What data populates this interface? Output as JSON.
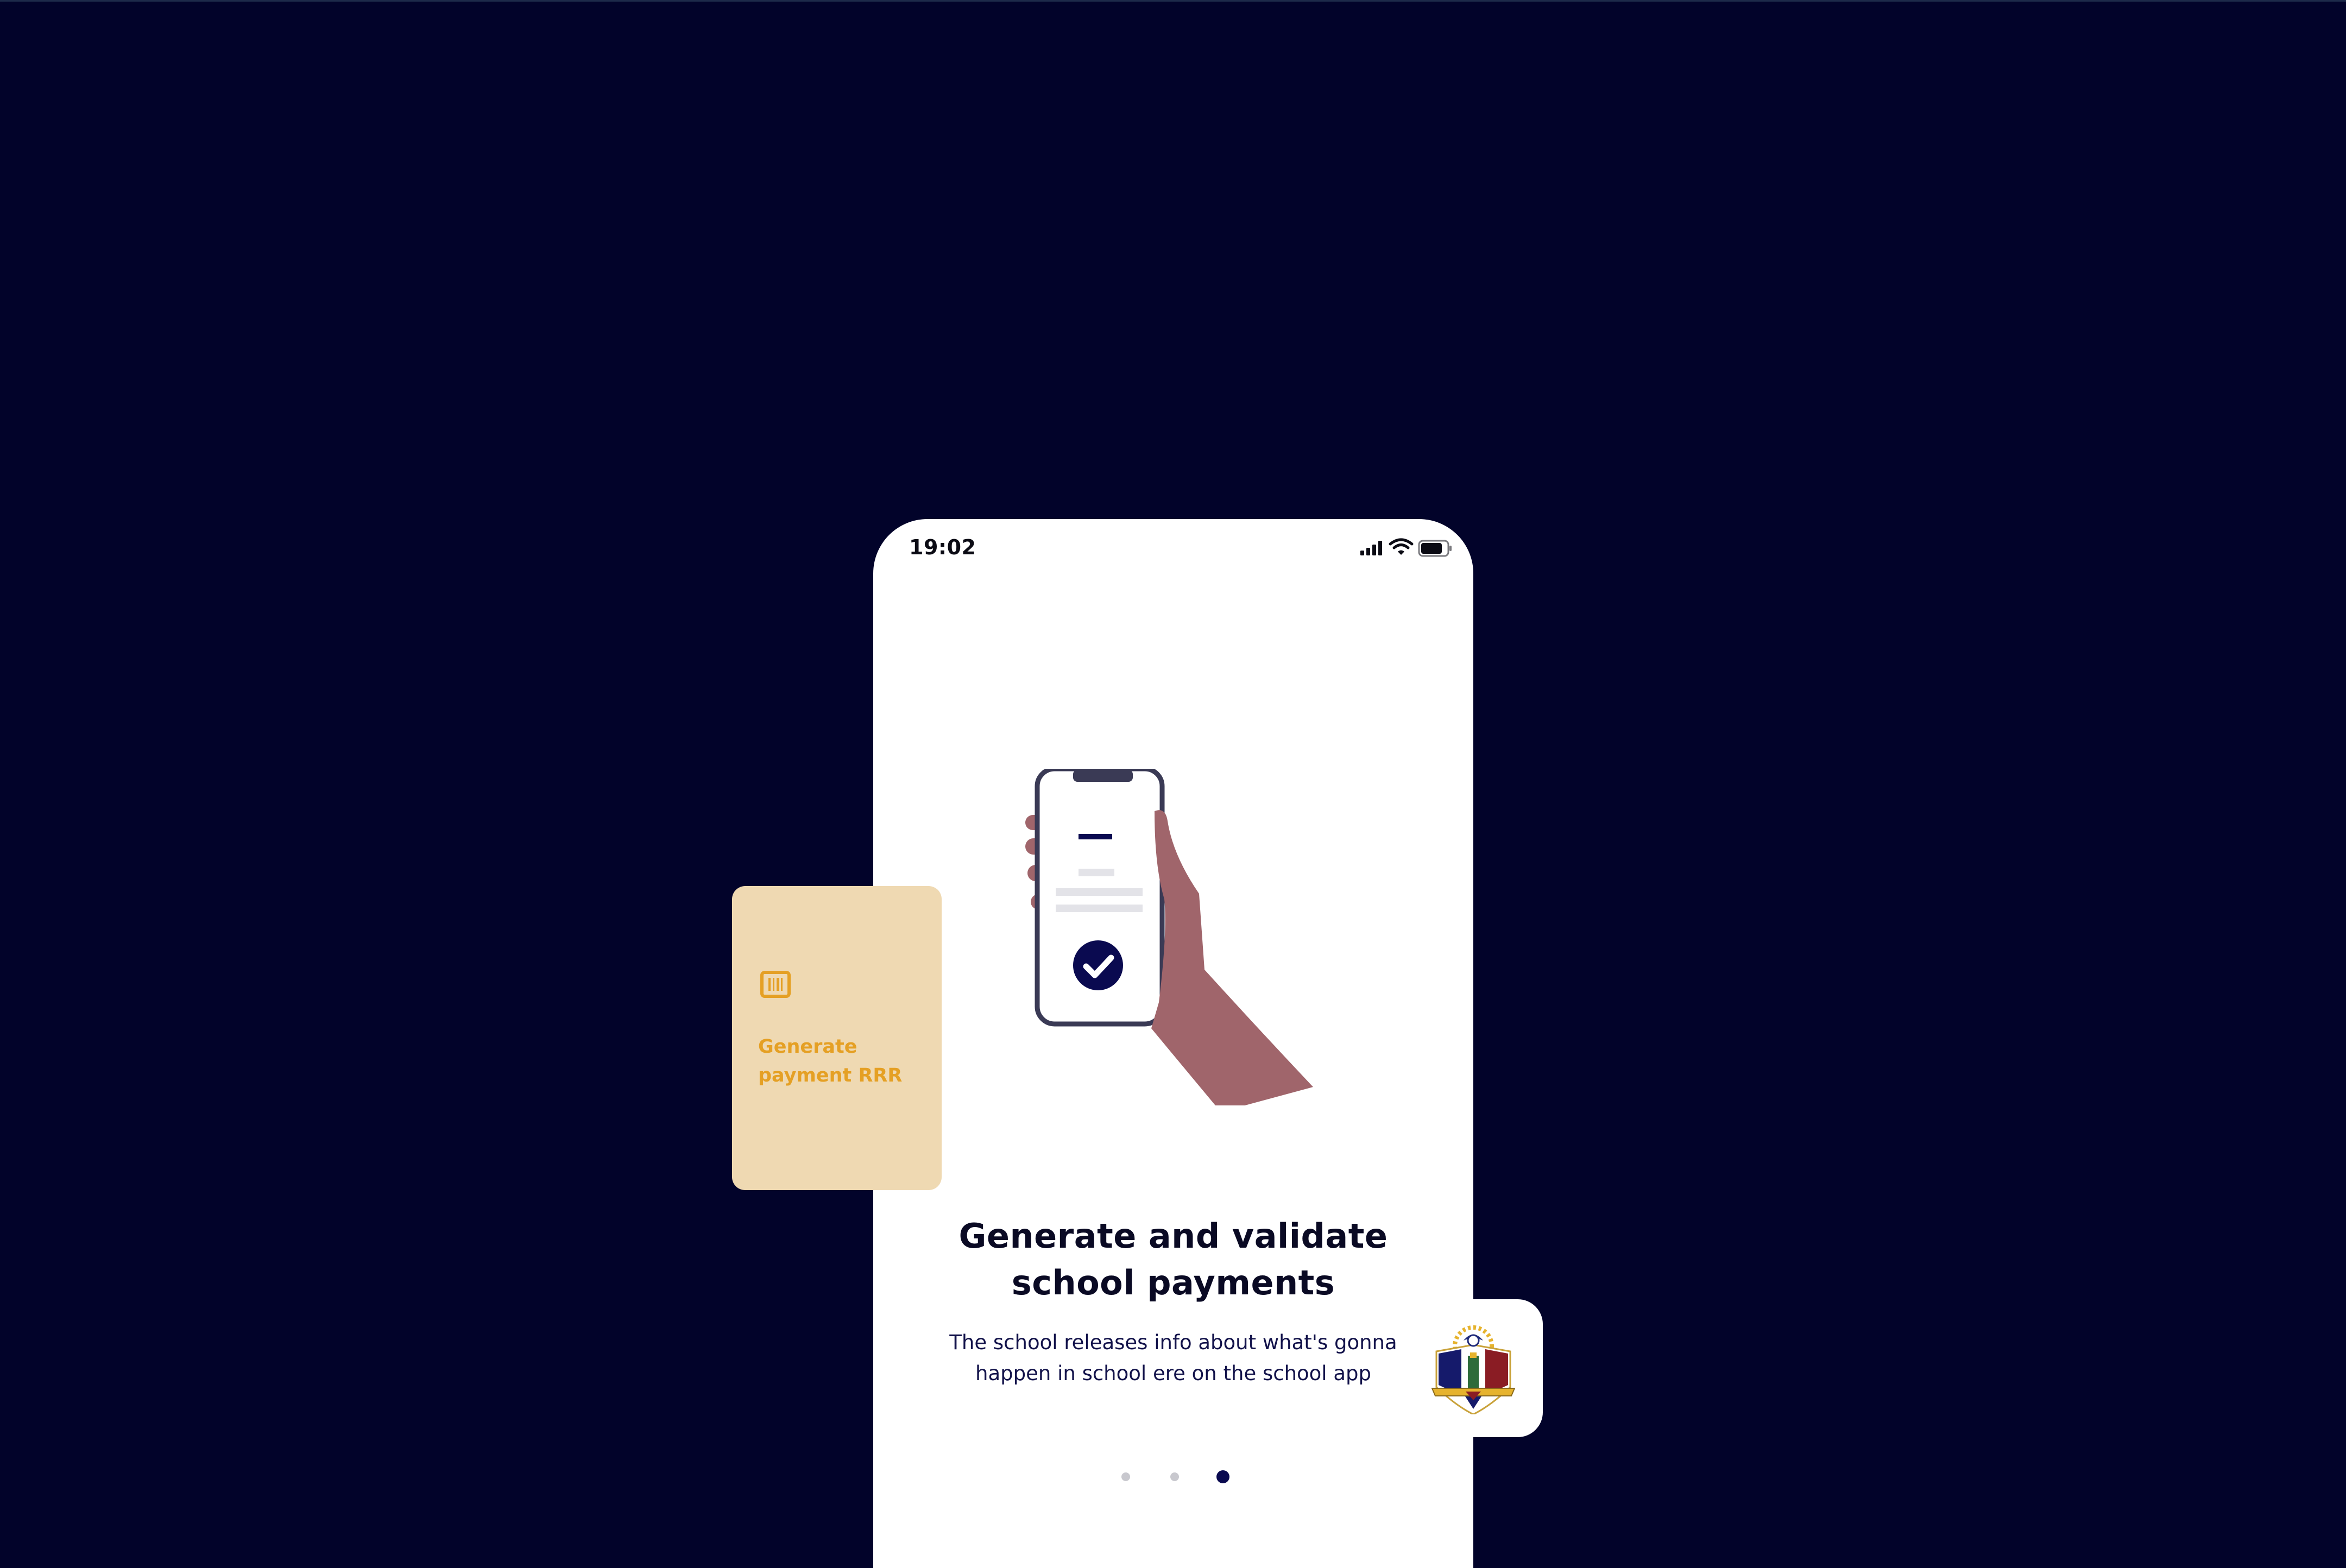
{
  "status_bar": {
    "time": "19:02",
    "icons": [
      "signal-icon",
      "wifi-icon",
      "battery-icon"
    ]
  },
  "onboarding": {
    "title_line1": "Generate and validate",
    "title_line2": "school payments",
    "description": "The school releases info about what's gonna happen in school ere on the school app",
    "pager": {
      "total": 3,
      "active": 3
    }
  },
  "feature_card": {
    "icon": "barcode-icon",
    "label_line1": "Generate",
    "label_line2": "payment RRR"
  },
  "app_logo": {
    "icon": "school-crest-icon"
  },
  "colors": {
    "background": "#02032A",
    "accent": "#0A0A50",
    "card": "#EFD9B2",
    "card_text": "#E5A024",
    "skin": "#A0656B"
  }
}
